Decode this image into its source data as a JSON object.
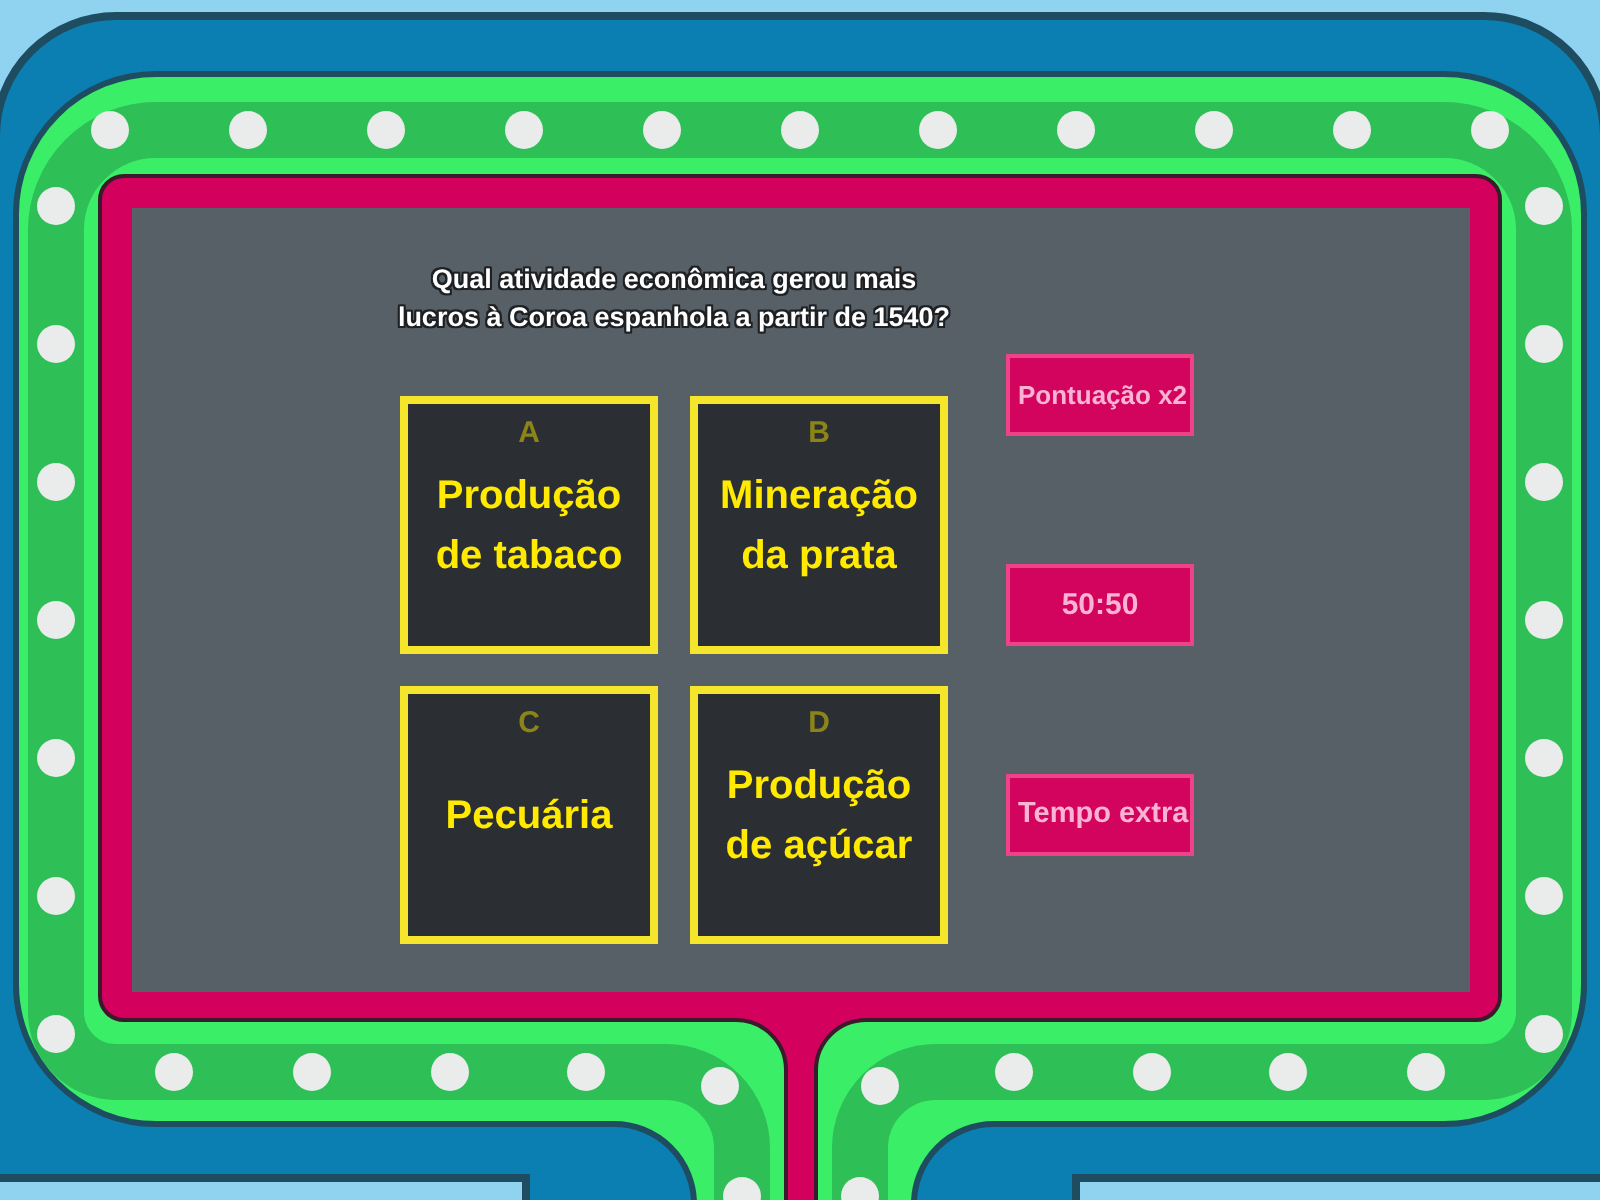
{
  "question_lines": [
    "Qual atividade econômica gerou mais",
    "lucros à Coroa espanhola a partir de 1540?"
  ],
  "answers": [
    {
      "letter": "A",
      "text": "Produção de tabaco"
    },
    {
      "letter": "B",
      "text": "Mineração da prata"
    },
    {
      "letter": "C",
      "text": "Pecuária"
    },
    {
      "letter": "D",
      "text": "Produção de açúcar"
    }
  ],
  "power_ups": [
    {
      "label": "Pontuação x2"
    },
    {
      "label": "50:50"
    },
    {
      "label": "Tempo extra"
    }
  ]
}
